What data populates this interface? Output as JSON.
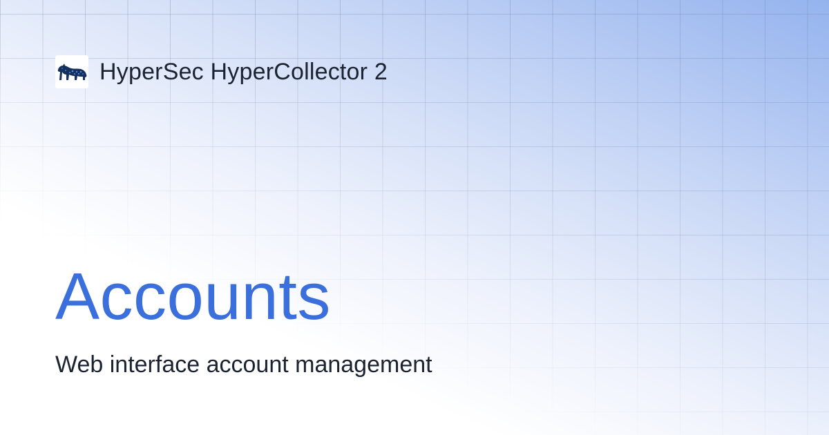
{
  "app": {
    "name": "HyperSec HyperCollector 2",
    "logo_icon": "panther-logo-icon"
  },
  "page": {
    "title": "Accounts",
    "subtitle": "Web interface account management"
  },
  "colors": {
    "title": "#3a6fdc",
    "text": "#1b2230",
    "gradient_corner": "#94b3ee",
    "background": "#ffffff"
  }
}
